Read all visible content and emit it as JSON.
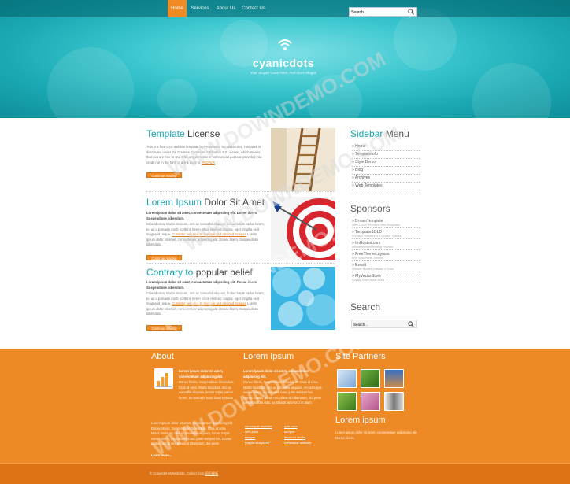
{
  "nav": {
    "items": [
      {
        "label": "Home",
        "active": true
      },
      {
        "label": "Services",
        "active": false
      },
      {
        "label": "About Us",
        "active": false
      },
      {
        "label": "Contact Us",
        "active": false
      }
    ],
    "search_value": "Search..."
  },
  "brand": {
    "name": "cyanicdots",
    "tagline": "Your Slogan Goes Here, And more Slogan"
  },
  "articles": [
    {
      "title_highlight": "Template",
      "title_rest": "License",
      "body": "This is a free CSS website template by ProtoWebs Templates.net. This work is distributed under the Creative Commons Attribution 3.0 License, which means that you are free to use it for any personal or commercial purpose provided you credit me in the form of a link back to",
      "link": "PROFER",
      "button": "Continue reading"
    },
    {
      "title_highlight": "Lorem Ipsum",
      "title_rest": "Dolor Sit Amet",
      "lead": "Lorem ipsum dolor sit amet, consectetuer adipiscing elit. Donec libero. Suspendisse bibendum.",
      "body": "Cras id urna. Morbi tincidunt, orci ac convallis aliquam, lectus turpis varius lorem, eu ac a posuere morb porttitor, lorem tellus eleifend magna, eget fringilla velit magna id neque.",
      "link": "Curabitur vel urna. In tristique sed eleifend semper.",
      "body2": "Lorem ipsum dolor sit amet, consectetuer adipiscing elit. Donec libero. Suspendisse bibendum.",
      "button": "Continue reading"
    },
    {
      "title_highlight": "Contrary to",
      "title_rest": "popular belief",
      "lead": "Lorem ipsum dolor sit amet, consectetuer adipiscing elit. Donec libero. Suspendisse bibendum.",
      "body": "Cras id urna. Morbi tincidunt, orci ac convallis aliquam, lectus turpis varius lorem, eu ac a posuere morb porttitor, lorem tellus eleifend magna, eget fringilla velit magna id neque.",
      "link": "Curabitur vel urna. In tristique sed eleifend semper.",
      "body2": "Lorem ipsum dolor sit amet, consectetuer adipiscing elit. Donec libero. Suspendisse bibendum.",
      "button": "Continue reading"
    }
  ],
  "sidebar": {
    "menu_title_highlight": "Sidebar",
    "menu_title_rest": "Menu",
    "menu": [
      "Home",
      "TemplateInfo",
      "Style Demo",
      "Blog",
      "Archives",
      "Web Templates"
    ],
    "sponsors_title": "Sponsors",
    "sponsors": [
      {
        "name": "DreamTemplate",
        "desc": "Over 6,000+ Premium Web Templates"
      },
      {
        "name": "TemplateSOLD",
        "desc": "Premium WordPress & Joomla Themes"
      },
      {
        "name": "ImHosted.com",
        "desc": "Affordable Web Hosting Provider"
      },
      {
        "name": "FreeThemeLayouts",
        "desc": "Free WordPress Themes"
      },
      {
        "name": "Evsoft",
        "desc": "Website Builder Software & Tools"
      },
      {
        "name": "MyVectorStore",
        "desc": "Royalty Free Vector Icons"
      }
    ],
    "search_title": "Search",
    "search_value": "Search..."
  },
  "footer": {
    "about_title": "About",
    "about_lead": "Lorem ipsum dolor sit amet, consectetuer adipiscing elit.",
    "about_text1": "Donec libero. Suspendisse bibendum. Cras id urna. Morbi tincidunt, orci ac convallis aliquam, lectus turpis varius lorem, eu posuere nunc justo tempus leo. Donec mattis, purus nec placerat bibendum, dui.",
    "about_text2": "Lorem ipsum dolor sit amet, consectetuer adipiscing elit. Donec libero. Suspendisse bibendum. Cras id urna. Morbi tincidunt, orci ac convallis aliquam, lectus turpis varius lorem, eu posuere nunc justo tempus leo. Donec mattis, purus nec placerat bibendum, dui pede condimentum odio. Cras id urna.",
    "about_more": "Learn more...",
    "lorem_title": "Lorem Ipsum",
    "lorem_lead": "Lorem ipsum dolor sit amet, consectetuer adipiscing elit.",
    "lorem_text": "Donec libero. Suspendisse bibendum. Cras id urna. Morbi tincidunt, orci ac convallis aliquam, lectus turpis varius lorem, eu posuere nunc justo tempus leo. Donec mattis, purus nec placerat bibendum, dui pede condimentum odio, ac blandit ante orci ut diam.",
    "links_left": [
      "consequat molestie",
      "sem justo",
      "semper",
      "magna sed purus"
    ],
    "links_right": [
      "quis urna",
      "semper",
      "tincidunt iaculis",
      "consequat molestie"
    ],
    "partners_title": "Site Partners",
    "partners_lorem_title": "Lorem ipsum",
    "partners_lorem_text": "Lorem ipsum dolor sit amet, consectetuer adipiscing elit. Donec libero.",
    "copyright": "© Copyright MyWebSite. Collect from",
    "copyright_link": "网页模板"
  },
  "watermark": "WWW.DOWNDEMO.COM",
  "colors": {
    "accent_cyan": "#1aa3b0",
    "accent_orange": "#ee8a26"
  }
}
